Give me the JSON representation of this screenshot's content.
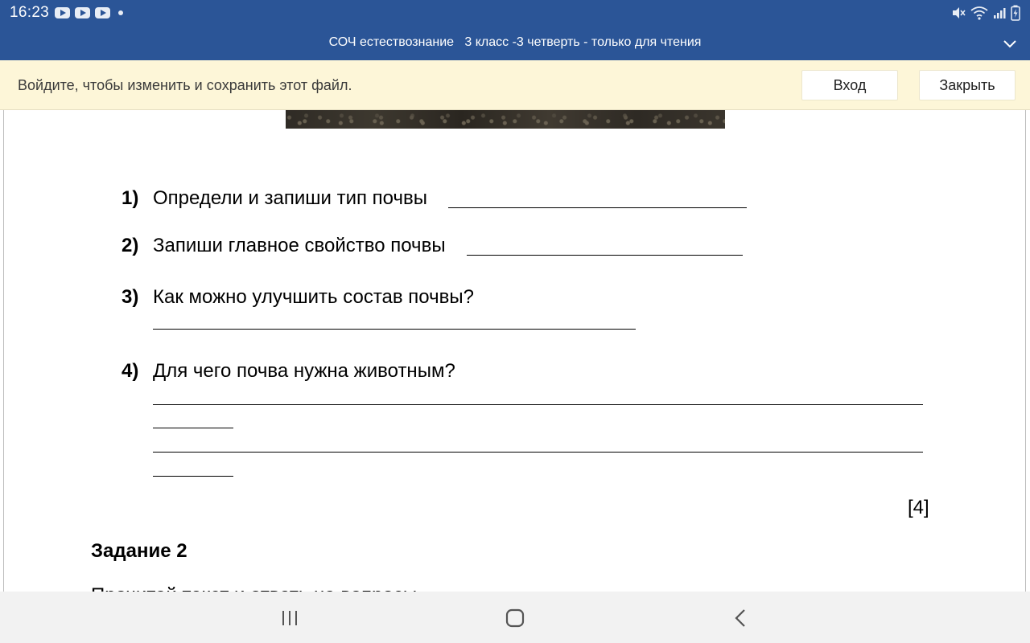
{
  "status_bar": {
    "time": "16:23",
    "left_icons": [
      "youtube-icon",
      "youtube-icon",
      "youtube-icon",
      "dot-icon"
    ],
    "right_icons": [
      "mute-icon",
      "wifi-icon",
      "signal-icon",
      "battery-charging-icon"
    ]
  },
  "title_bar": {
    "title": "СОЧ естествознание   3 класс -3 четверть - только для чтения",
    "expand_icon": "chevron-down-icon"
  },
  "notice": {
    "text": "Войдите, чтобы изменить и сохранить этот файл.",
    "login_label": "Вход",
    "close_label": "Закрыть"
  },
  "document": {
    "questions": [
      {
        "num": "1)",
        "text": "Определи и запиши тип почвы"
      },
      {
        "num": "2)",
        "text": "Запиши главное свойство почвы"
      },
      {
        "num": "3)",
        "text": "Как можно улучшить состав почвы?"
      },
      {
        "num": "4)",
        "text": "Для чего почва нужна животным?"
      }
    ],
    "score": "[4]",
    "task_title": "Задание 2",
    "cut_text": "Прочитай текст и ответь на вопросы"
  },
  "nav_bar": {
    "icons": [
      "recents-icon",
      "home-icon",
      "back-icon"
    ]
  },
  "colors": {
    "header_blue": "#2b5597",
    "notice_yellow": "#fdf6d8",
    "nav_gray": "#f2f2f2"
  }
}
